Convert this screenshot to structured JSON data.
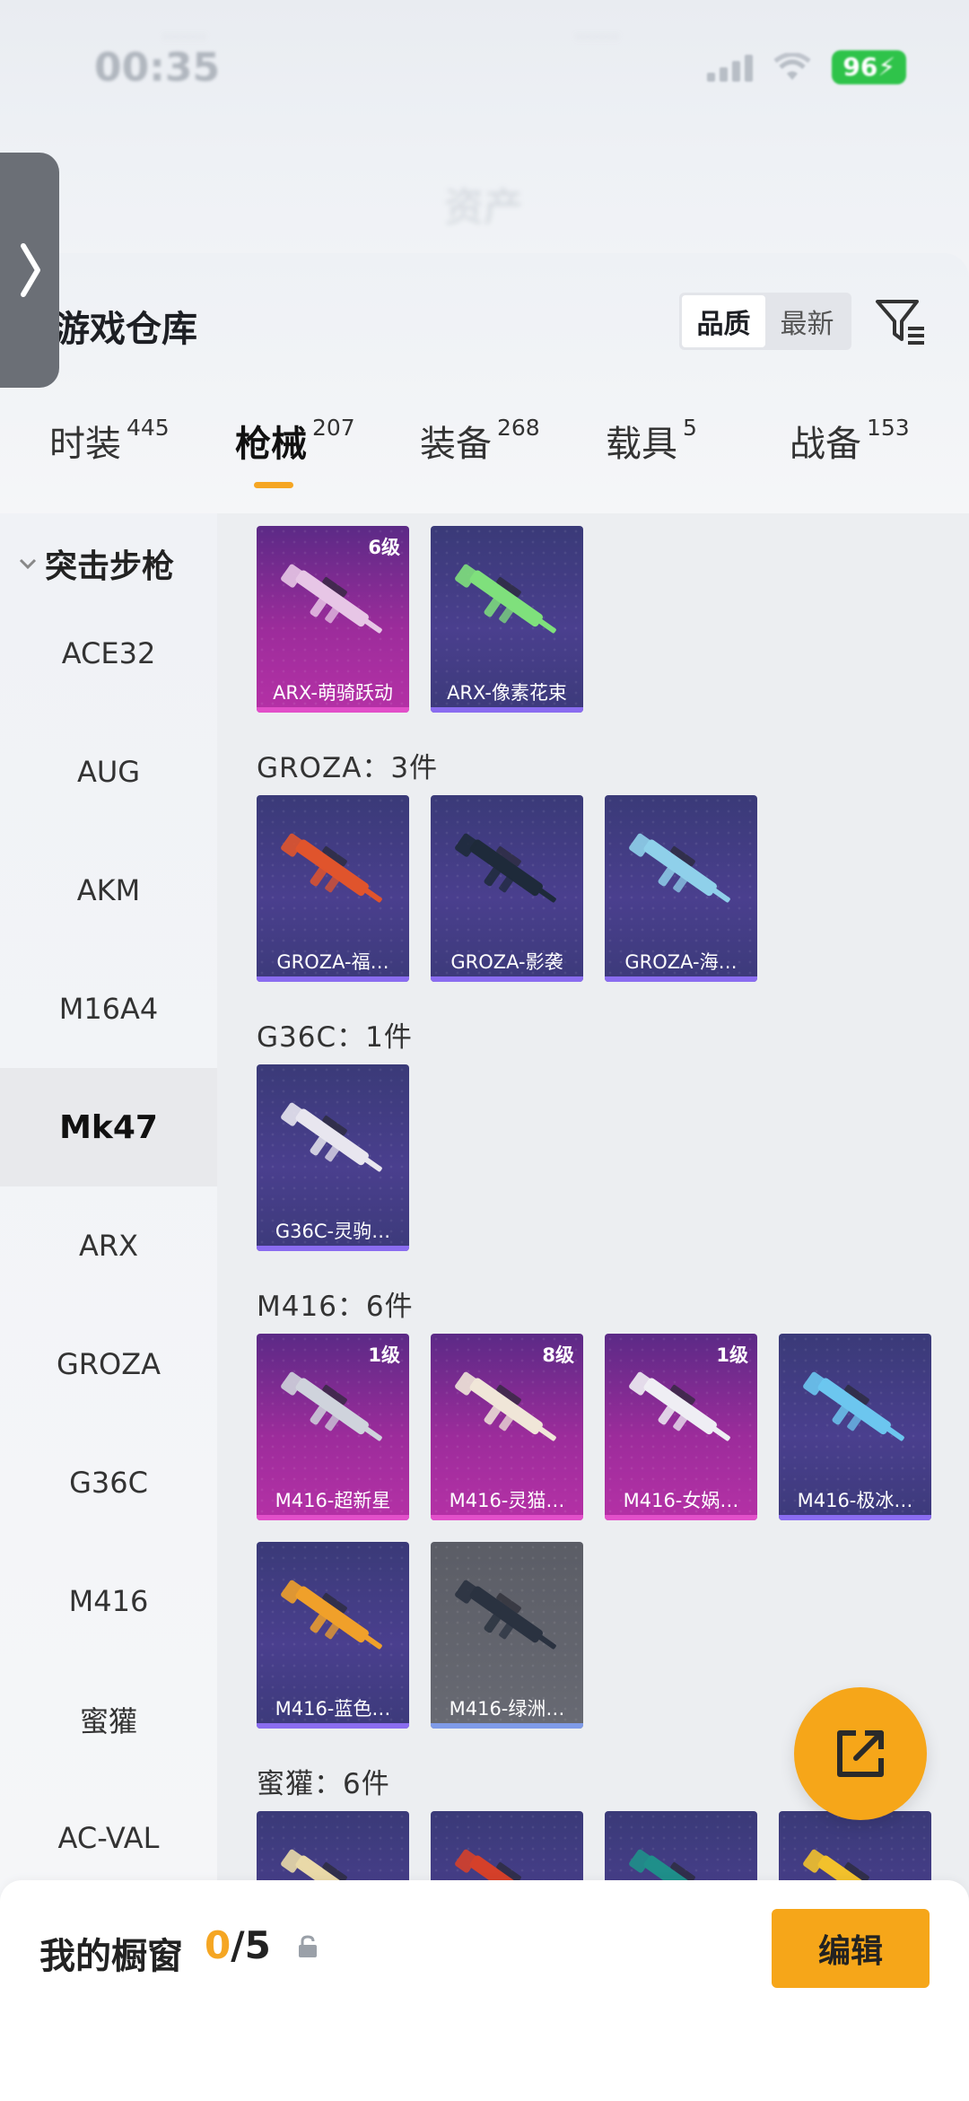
{
  "status_bar": {
    "time": "00:35",
    "battery": "96"
  },
  "header_title_blurred": "资产",
  "panel": {
    "title": "游戏仓库",
    "sort_options": [
      "品质",
      "最新"
    ],
    "active_sort": "品质"
  },
  "tabs": [
    {
      "label": "时装",
      "count": "445"
    },
    {
      "label": "枪械",
      "count": "207",
      "active": true
    },
    {
      "label": "装备",
      "count": "268"
    },
    {
      "label": "载具",
      "count": "5"
    },
    {
      "label": "战备",
      "count": "153"
    }
  ],
  "sidebar": {
    "category": "突击步枪",
    "items": [
      "ACE32",
      "AUG",
      "AKM",
      "M16A4",
      "Mk47",
      "ARX",
      "GROZA",
      "G36C",
      "M416",
      "蜜獾",
      "AC-VAL"
    ],
    "active_item": "Mk47"
  },
  "groups": [
    {
      "title": "",
      "items": [
        {
          "name": "ARX-萌骑跃动",
          "level": "6级",
          "rarity": "purple",
          "gun_color": "#e7c6e6"
        },
        {
          "name": "ARX-像素花束",
          "level": "",
          "rarity": "blue",
          "gun_color": "#7fe07c"
        }
      ]
    },
    {
      "title": "GROZA：3件",
      "items": [
        {
          "name": "GROZA-福…",
          "level": "",
          "rarity": "blue",
          "gun_color": "#e0542c"
        },
        {
          "name": "GROZA-影袭",
          "level": "",
          "rarity": "blue",
          "gun_color": "#1e2a3a"
        },
        {
          "name": "GROZA-海…",
          "level": "",
          "rarity": "blue",
          "gun_color": "#8fd0ea"
        }
      ]
    },
    {
      "title": "G36C：1件",
      "items": [
        {
          "name": "G36C-灵驹…",
          "level": "",
          "rarity": "blue",
          "gun_color": "#e8e6ef"
        }
      ]
    },
    {
      "title": "M416：6件",
      "items": [
        {
          "name": "M416-超新星",
          "level": "1级",
          "rarity": "purple",
          "gun_color": "#cfd3dc"
        },
        {
          "name": "M416-灵猫…",
          "level": "8级",
          "rarity": "purple",
          "gun_color": "#f0e6d8"
        },
        {
          "name": "M416-女娲…",
          "level": "1级",
          "rarity": "purple",
          "gun_color": "#efeef4"
        },
        {
          "name": "M416-极冰…",
          "level": "",
          "rarity": "blue",
          "gun_color": "#6cc6ef"
        },
        {
          "name": "M416-蓝色…",
          "level": "",
          "rarity": "blue",
          "gun_color": "#f0a02a"
        },
        {
          "name": "M416-绿洲…",
          "level": "",
          "rarity": "gray",
          "gun_color": "#2a3240"
        }
      ]
    },
    {
      "title": "蜜獾：6件",
      "items": [
        {
          "name": "",
          "level": "",
          "rarity": "blue",
          "gun_color": "#e9d9a8"
        },
        {
          "name": "",
          "level": "",
          "rarity": "blue",
          "gun_color": "#d5402a"
        },
        {
          "name": "",
          "level": "",
          "rarity": "blue",
          "gun_color": "#1f8f8a"
        },
        {
          "name": "",
          "level": "",
          "rarity": "blue",
          "gun_color": "#f2c12c"
        }
      ]
    }
  ],
  "bottom": {
    "showcase_label": "我的橱窗",
    "showcase_current": "0",
    "showcase_total": "/5",
    "edit_label": "编辑"
  },
  "colors": {
    "accent": "#f6a619",
    "purple_rarity": "#b531a6",
    "blue_rarity": "#4a3f8e"
  }
}
